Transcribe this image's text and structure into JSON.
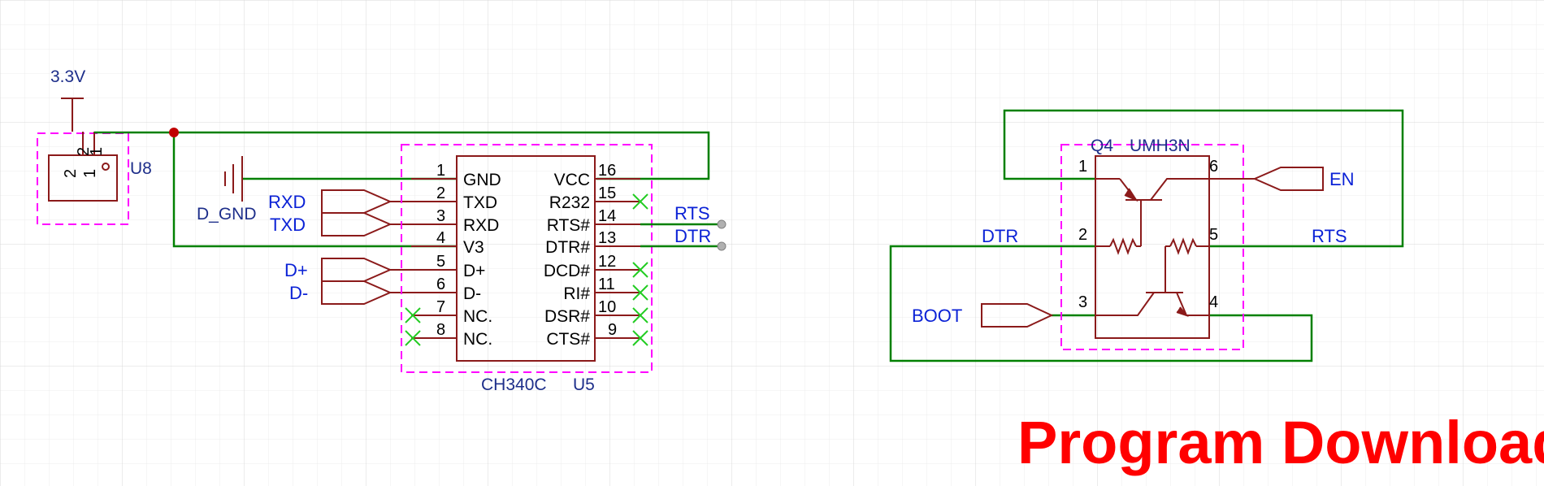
{
  "colors": {
    "background": "#ffffff",
    "grid": "#e6e6e6",
    "grid_major": "#d0d0d0",
    "wire": "#008000",
    "component": "#8b1a1a",
    "outline": "#ff00ff",
    "net_label": "#0b22d6",
    "designator": "#1d2e8a",
    "no_connect": "#22cc22",
    "junction": "#c00000",
    "title": "#ff0000"
  },
  "power": {
    "vcc_label": "3.3V",
    "gnd_label": "D_GND"
  },
  "u8": {
    "designator": "U8",
    "pin_top_2": "2",
    "pin_top_1": "1",
    "pin_body_2": "2",
    "pin_body_1": "1"
  },
  "u5": {
    "part": "CH340C",
    "designator": "U5",
    "left_pins": [
      {
        "num": "1",
        "name": "GND"
      },
      {
        "num": "2",
        "name": "TXD"
      },
      {
        "num": "3",
        "name": "RXD"
      },
      {
        "num": "4",
        "name": "V3"
      },
      {
        "num": "5",
        "name": "D+"
      },
      {
        "num": "6",
        "name": "D-"
      },
      {
        "num": "7",
        "name": "NC."
      },
      {
        "num": "8",
        "name": "NC."
      }
    ],
    "right_pins": [
      {
        "num": "16",
        "name": "VCC"
      },
      {
        "num": "15",
        "name": "R232"
      },
      {
        "num": "14",
        "name": "RTS#"
      },
      {
        "num": "13",
        "name": "DTR#"
      },
      {
        "num": "12",
        "name": "DCD#"
      },
      {
        "num": "11",
        "name": "RI#"
      },
      {
        "num": "10",
        "name": "DSR#"
      },
      {
        "num": "9",
        "name": "CTS#"
      }
    ]
  },
  "net_ports_left": {
    "rxd": "RXD",
    "txd": "TXD",
    "dp": "D+",
    "dm": "D-"
  },
  "net_ports_right": {
    "rts": "RTS",
    "dtr": "DTR"
  },
  "q4": {
    "designator": "Q4",
    "part": "UMH3N",
    "pins": [
      "1",
      "2",
      "3",
      "4",
      "5",
      "6"
    ]
  },
  "q4_nets": {
    "dtr": "DTR",
    "rts": "RTS",
    "boot": "BOOT",
    "en": "EN"
  },
  "page_title": "Program Download"
}
